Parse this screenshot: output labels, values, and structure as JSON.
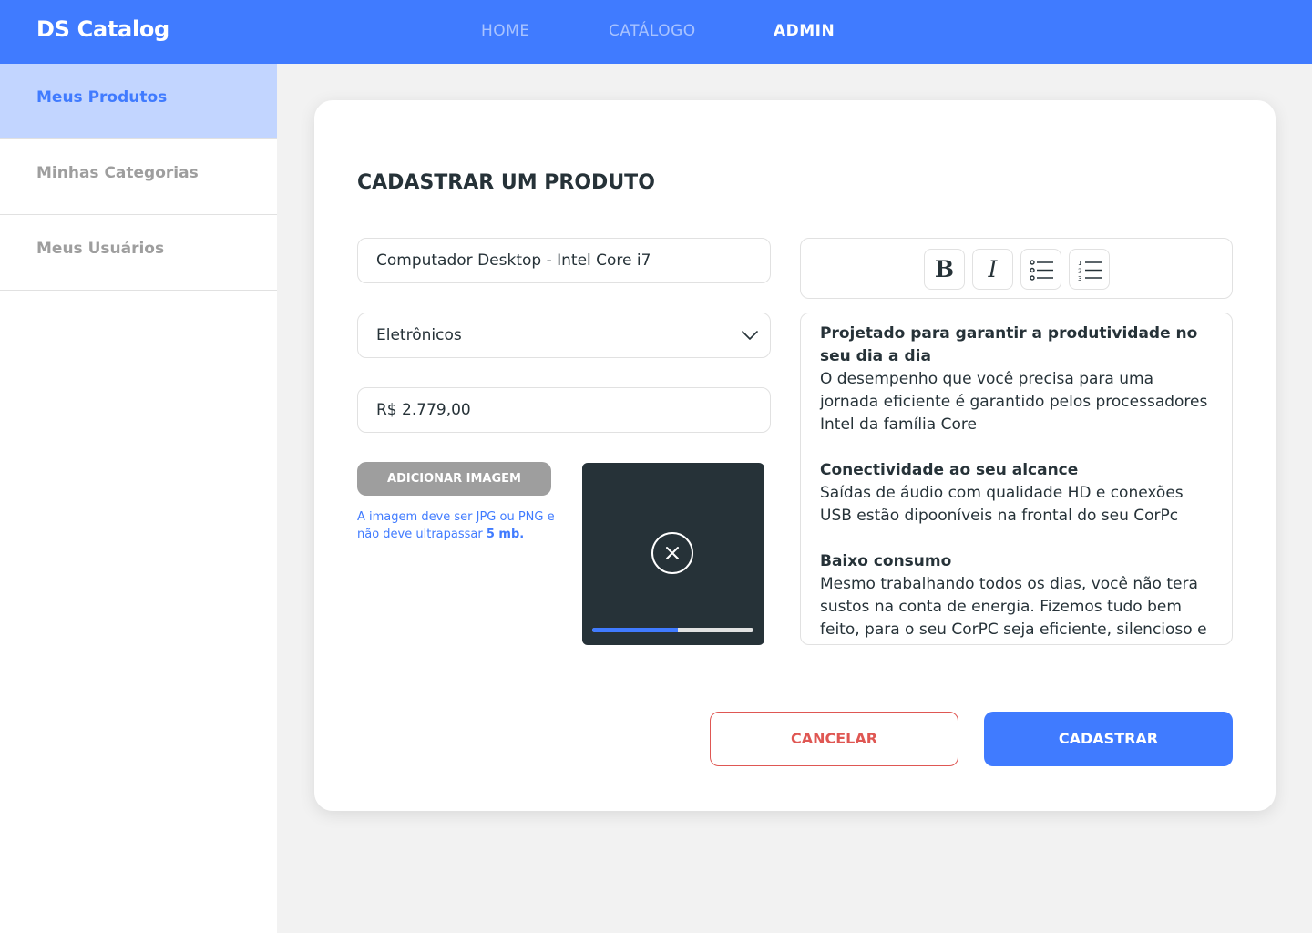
{
  "navbar": {
    "brand": "DS Catalog",
    "links": [
      "HOME",
      "CATÁLOGO",
      "ADMIN"
    ],
    "active_link": "ADMIN"
  },
  "sidebar": {
    "items": [
      {
        "label": "Meus Produtos",
        "active": true
      },
      {
        "label": "Minhas Categorias",
        "active": false
      },
      {
        "label": "Meus Usuários",
        "active": false
      }
    ]
  },
  "form": {
    "title": "CADASTRAR UM PRODUTO",
    "name_value": "Computador Desktop - Intel Core i7",
    "category_value": "Eletrônicos",
    "price_value": "R$ 2.779,00",
    "add_image_label": "ADICIONAR IMAGEM",
    "hint_text": "A imagem deve ser  JPG ou PNG e não deve ultrapassar ",
    "hint_limit": "5 mb.",
    "upload_progress": 0.53
  },
  "editor": {
    "toolbar": {
      "bold": "B",
      "italic": "I",
      "bullet_list": "bullet-list-icon",
      "numbered_list": "numbered-list-icon"
    },
    "paragraphs": [
      {
        "heading": "Projetado para garantir a produtividade no seu dia a dia",
        "body": "O desempenho que você precisa para uma jornada eficiente é garantido pelos processadores Intel da família Core"
      },
      {
        "heading": "Conectividade ao seu alcance",
        "body": "Saídas de áudio com qualidade HD e conexões USB estão dipooníveis na frontal do seu CorPc"
      },
      {
        "heading": "Baixo consumo",
        "body": "Mesmo trabalhando todos os dias, você não tera sustos na conta de energia. Fizemos tudo bem feito, para o seu CorPC seja eficiente, silencioso e"
      }
    ]
  },
  "actions": {
    "cancel_label": "CANCELAR",
    "submit_label": "CADASTRAR"
  },
  "colors": {
    "primary": "#407BFF",
    "primary_light": "#C2D5FF",
    "danger": "#DF5753",
    "dark": "#263238",
    "gray": "#9E9E9E",
    "border": "#E1E1E1",
    "background": "#F2F2F2"
  }
}
